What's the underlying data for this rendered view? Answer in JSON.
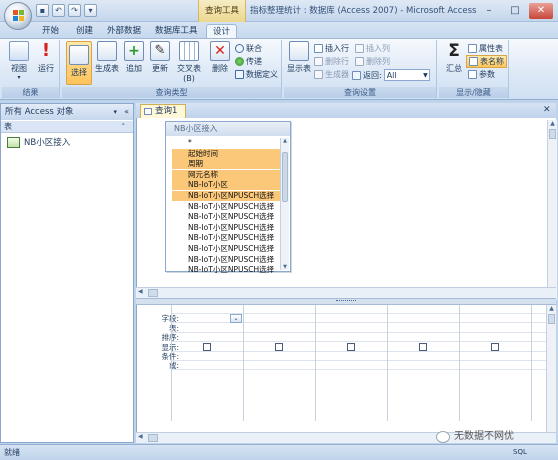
{
  "titlebar": {
    "context_tab": "查询工具",
    "window_title": "指标整理统计 : 数据库 (Access 2007) - Microsoft Access",
    "qat": {
      "save": "▪",
      "undo": "↶",
      "redo": "↷"
    },
    "minimize": "–",
    "maximize": "□",
    "close": "✕"
  },
  "tabs": [
    "开始",
    "创建",
    "外部数据",
    "数据库工具",
    "设计"
  ],
  "ribbon": {
    "groups": {
      "results": "结果",
      "query_type": "查询类型",
      "query_setup": "查询设置",
      "show_hide": "显示/隐藏"
    },
    "results": {
      "view": "视图",
      "run": "运行"
    },
    "query_type": {
      "select": "选择",
      "make_table": "生成表",
      "append": "追加",
      "update": "更新",
      "crosstab": "交叉表(B)",
      "delete": "删除",
      "union": "联合",
      "passthrough": "传递",
      "data_definition": "数据定义"
    },
    "query_setup": {
      "show_table": "显示表",
      "insert_rows": "插入行",
      "delete_rows": "删除行",
      "builder": "生成器",
      "insert_cols": "插入列",
      "delete_cols": "删除列",
      "return_label": "返回:",
      "return_value": "All"
    },
    "show_hide": {
      "totals": "汇总",
      "property_sheet": "属性表",
      "table_names": "表名称",
      "parameters": "参数"
    }
  },
  "nav": {
    "header": "所有 Access 对象",
    "group": "表",
    "items": [
      "NB小区接入"
    ]
  },
  "document": {
    "tab": "查询1",
    "table": {
      "name": "NB小区接入",
      "fields": [
        "*",
        "起始时间",
        "周期",
        "网元名称",
        "NB-IoT小区",
        "NB-IoT小区NPUSCH选择",
        "NB-IoT小区NPUSCH选择",
        "NB-IoT小区NPUSCH选择",
        "NB-IoT小区NPUSCH选择",
        "NB-IoT小区NPUSCH选择",
        "NB-IoT小区NPUSCH选择",
        "NB-IoT小区NPUSCH选择",
        "NB-IoT小区NPUSCH选择"
      ],
      "selected_fields": [
        1,
        2,
        3,
        4,
        5
      ]
    },
    "grid_rows": [
      "字段:",
      "表:",
      "排序:",
      "显示:",
      "条件:",
      "或:"
    ],
    "grid_columns": 5,
    "grid_scroll_label": "▸"
  },
  "status": {
    "left": "就绪",
    "watermark": "无数据不网优",
    "view_icons": "SQL"
  }
}
